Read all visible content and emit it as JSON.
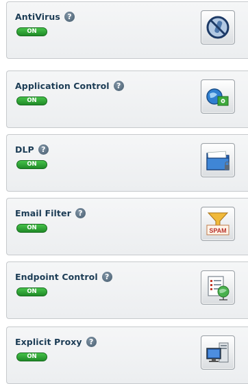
{
  "features": [
    {
      "title": "AntiVirus",
      "help": "?",
      "toggle": "ON",
      "icon": "antivirus-icon"
    },
    {
      "title": "Application Control",
      "help": "?",
      "toggle": "ON",
      "icon": "application-control-icon"
    },
    {
      "title": "DLP",
      "help": "?",
      "toggle": "ON",
      "icon": "dlp-folder-icon"
    },
    {
      "title": "Email Filter",
      "help": "?",
      "toggle": "ON",
      "icon": "spam-filter-icon"
    },
    {
      "title": "Endpoint Control",
      "help": "?",
      "toggle": "ON",
      "icon": "endpoint-control-icon"
    },
    {
      "title": "Explicit Proxy",
      "help": "?",
      "toggle": "ON",
      "icon": "explicit-proxy-icon"
    }
  ],
  "spam_text": "SPAM",
  "colors": {
    "toggle_on": "#2aa335",
    "title": "#1c3c55",
    "help": "#54697a"
  }
}
